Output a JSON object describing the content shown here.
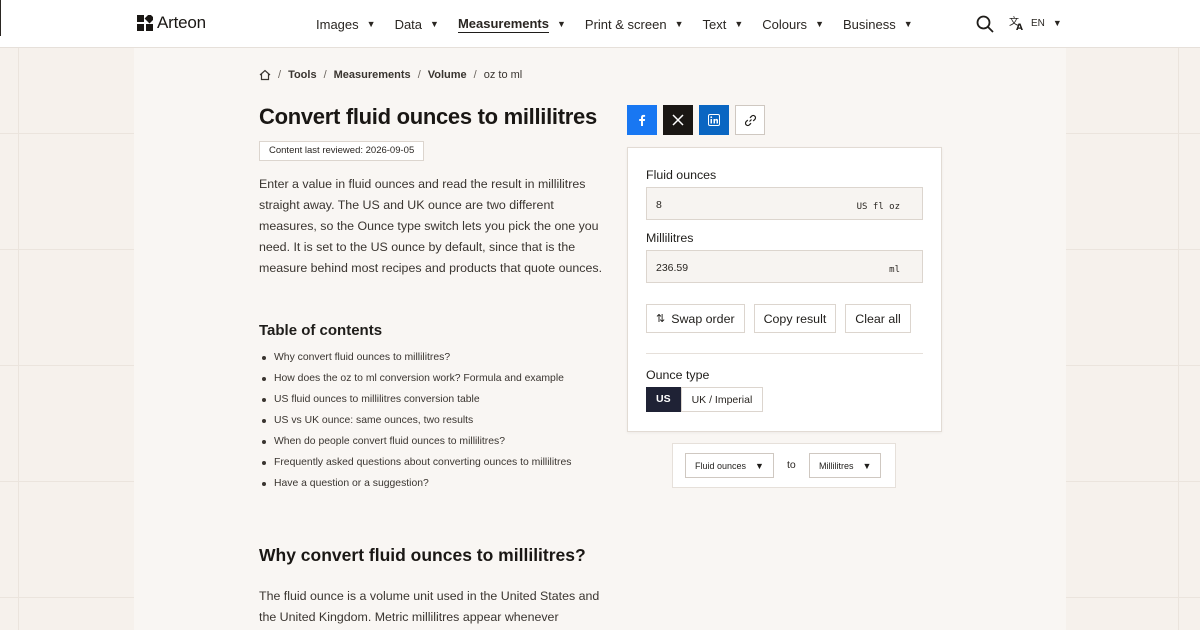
{
  "brand": {
    "name": "Arteon"
  },
  "nav": {
    "items": [
      {
        "label": "Images",
        "active": false
      },
      {
        "label": "Data",
        "active": false
      },
      {
        "label": "Measurements",
        "active": true
      },
      {
        "label": "Print & screen",
        "active": false
      },
      {
        "label": "Text",
        "active": false
      },
      {
        "label": "Colours",
        "active": false
      },
      {
        "label": "Business",
        "active": false
      }
    ],
    "language": "EN",
    "search_icon": "search-icon",
    "translate_icon": "translate-icon"
  },
  "breadcrumb": {
    "home_icon": "home-icon",
    "items": [
      "Tools",
      "Measurements",
      "Volume"
    ],
    "current": "oz to ml"
  },
  "page": {
    "title": "Convert fluid ounces to millilitres",
    "reviewed": "Content last reviewed: 2026-09-05",
    "intro": "Enter a value in fluid ounces and read the result in millilitres straight away. The US and UK ounce are two different measures, so the Ounce type switch lets you pick the one you need. It is set to the US ounce by default, since that is the measure behind most recipes and products that quote ounces."
  },
  "toc": {
    "title": "Table of contents",
    "items": [
      "Why convert fluid ounces to millilitres?",
      "How does the oz to ml conversion work? Formula and example",
      "US fluid ounces to millilitres conversion table",
      "US vs UK ounce: same ounces, two results",
      "When do people convert fluid ounces to millilitres?",
      "Frequently asked questions about converting ounces to millilitres",
      "Have a question or a suggestion?"
    ]
  },
  "section": {
    "title": "Why convert fluid ounces to millilitres?",
    "text": "The fluid ounce is a volume unit used in the United States and the United Kingdom. Metric millilitres appear whenever"
  },
  "share": {
    "buttons": [
      "facebook-icon",
      "x-icon",
      "linkedin-icon",
      "link-icon"
    ]
  },
  "converter": {
    "from_label": "Fluid ounces",
    "from_value": "8",
    "from_unit": "US fl oz",
    "to_label": "Millilitres",
    "to_value": "236.59",
    "to_unit": "ml",
    "swap_label": "Swap order",
    "copy_label": "Copy result",
    "clear_label": "Clear all",
    "ounce_type_label": "Ounce type",
    "ounce_options": [
      "US",
      "UK / Imperial"
    ],
    "ounce_selected": "US"
  },
  "unit_picker": {
    "from": "Fluid ounces",
    "to_word": "to",
    "to": "Millilitres"
  },
  "colors": {
    "accent_dark": "#1f2235",
    "facebook": "#1877f2",
    "linkedin": "#0a66c2",
    "background": "#f6f1ec"
  }
}
